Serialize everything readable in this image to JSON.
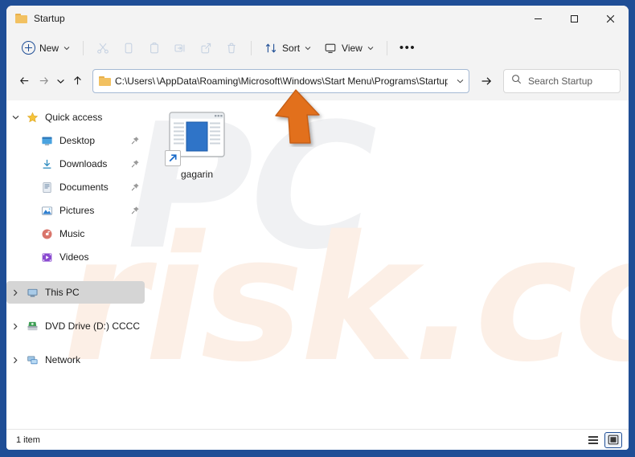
{
  "window": {
    "title": "Startup",
    "title_icon": "folder-icon",
    "controls": {
      "minimize": "–",
      "maximize": "☐",
      "close": "✕"
    },
    "border_color": "#1f4e96"
  },
  "toolbar": {
    "new_label": "New",
    "new_icon": "plus-circle-icon",
    "actions": [
      {
        "name": "cut",
        "icon": "scissors-icon",
        "disabled": true
      },
      {
        "name": "copy",
        "icon": "copy-icon",
        "disabled": true
      },
      {
        "name": "paste",
        "icon": "clipboard-icon",
        "disabled": true
      },
      {
        "name": "rename",
        "icon": "rename-icon",
        "disabled": true
      },
      {
        "name": "share",
        "icon": "share-icon",
        "disabled": true
      },
      {
        "name": "delete",
        "icon": "trash-icon",
        "disabled": true
      }
    ],
    "sort_label": "Sort",
    "sort_icon": "sort-arrows-icon",
    "view_label": "View",
    "view_icon": "monitor-icon",
    "more_label": "•••",
    "chevron": "⌄"
  },
  "navigation": {
    "back_icon": "arrow-left-icon",
    "forward_icon": "arrow-right-icon",
    "recent_icon": "chevron-down-icon",
    "up_icon": "arrow-up-icon",
    "go_icon": "arrow-right-icon"
  },
  "address": {
    "folder_icon": "folder-icon",
    "path_prefix": "C:\\Users\\",
    "redacted": true,
    "path_suffix": "\\AppData\\Roaming\\Microsoft\\Windows\\Start Menu\\Programs\\Startup",
    "dropdown_chevron": "⌄"
  },
  "search": {
    "icon": "search-icon",
    "placeholder": "Search Startup",
    "value": ""
  },
  "sidebar": {
    "items": [
      {
        "label": "Quick access",
        "icon": "star-icon",
        "twisty": "⌄",
        "level": 0,
        "pin": false,
        "selected": false
      },
      {
        "label": "Desktop",
        "icon": "desktop-icon",
        "twisty": "",
        "level": 1,
        "pin": true,
        "selected": false
      },
      {
        "label": "Downloads",
        "icon": "downloads-icon",
        "twisty": "",
        "level": 1,
        "pin": true,
        "selected": false
      },
      {
        "label": "Documents",
        "icon": "documents-icon",
        "twisty": "",
        "level": 1,
        "pin": true,
        "selected": false
      },
      {
        "label": "Pictures",
        "icon": "pictures-icon",
        "twisty": "",
        "level": 1,
        "pin": true,
        "selected": false
      },
      {
        "label": "Music",
        "icon": "music-icon",
        "twisty": "",
        "level": 1,
        "pin": false,
        "selected": false
      },
      {
        "label": "Videos",
        "icon": "videos-icon",
        "twisty": "",
        "level": 1,
        "pin": false,
        "selected": false
      },
      {
        "label": "This PC",
        "icon": "this-pc-icon",
        "twisty": "›",
        "level": 0,
        "pin": false,
        "selected": true
      },
      {
        "label": "DVD Drive (D:) CCCC",
        "icon": "dvd-drive-icon",
        "twisty": "›",
        "level": 0,
        "pin": false,
        "selected": false
      },
      {
        "label": "Network",
        "icon": "network-icon",
        "twisty": "›",
        "level": 0,
        "pin": false,
        "selected": false
      }
    ]
  },
  "content": {
    "files": [
      {
        "name": "gagarin",
        "icon": "application-shortcut-icon",
        "shortcut": true
      }
    ]
  },
  "statusbar": {
    "item_count": "1 item",
    "views": [
      {
        "name": "details-view",
        "icon": "list-lines-icon",
        "active": false
      },
      {
        "name": "large-icons-view",
        "icon": "large-icon-tile-icon",
        "active": true
      }
    ]
  },
  "annotation": {
    "arrow_icon": "orange-arrow-up-icon",
    "arrow_color": "#e2701e",
    "points_at": "address-bar"
  },
  "watermark": {
    "part1": "PC",
    "part2": "risk.com",
    "part1_color": "#f0f1f3",
    "part2_color": "#fcefe6"
  }
}
